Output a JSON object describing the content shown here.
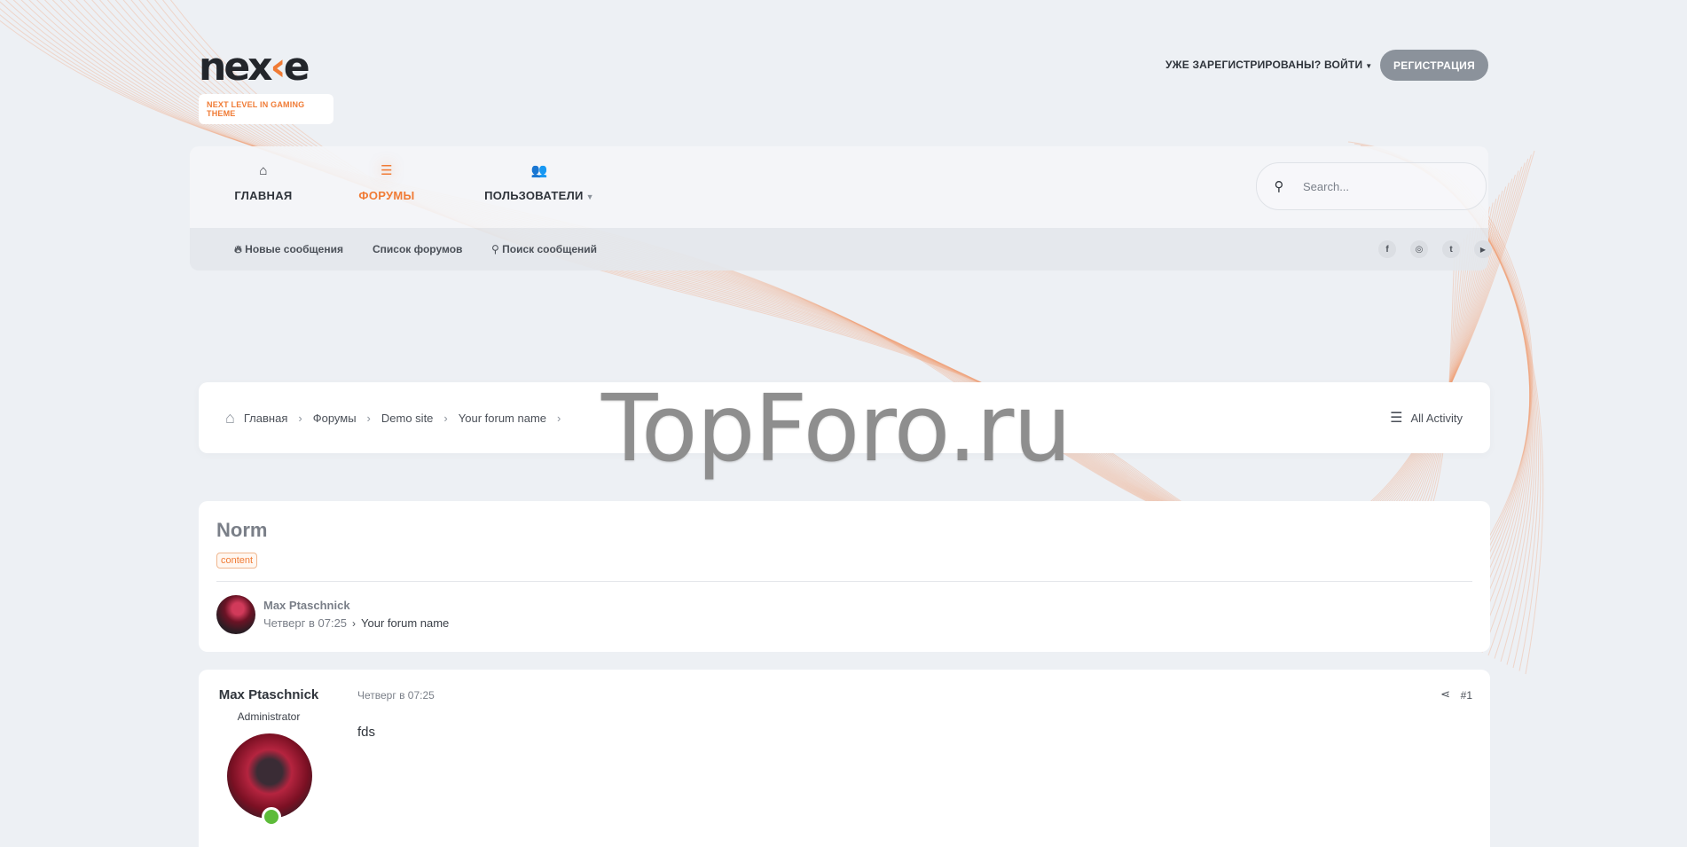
{
  "header": {
    "logo_prefix": "nex",
    "logo_accent": "‹",
    "logo_suffix": "e",
    "tagline": "NEXT LEVEL IN GAMING THEME",
    "login_label": "УЖЕ ЗАРЕГИСТРИРОВАНЫ? ВОЙТИ",
    "register_label": "РЕГИСТРАЦИЯ"
  },
  "nav": {
    "items": [
      {
        "label": "ГЛАВНАЯ",
        "icon": "home-icon",
        "active": false
      },
      {
        "label": "ФОРУМЫ",
        "icon": "list-icon",
        "active": true
      },
      {
        "label": "ПОЛЬЗОВАТЕЛИ",
        "icon": "users-icon",
        "active": false
      }
    ],
    "search_placeholder": "Search..."
  },
  "subnav": {
    "new_posts": "Новые сообщения",
    "forum_list": "Список форумов",
    "search_posts": "Поиск сообщений",
    "social": [
      "f",
      "◎",
      "t",
      "▶"
    ]
  },
  "breadcrumb": {
    "items": [
      "Главная",
      "Форумы",
      "Demo site",
      "Your forum name"
    ],
    "all_activity": "All Activity"
  },
  "watermark": "TopForo.ru",
  "thread": {
    "title": "Norm",
    "tag": "content",
    "author": "Max Ptaschnick",
    "date": "Четверг в 07:25",
    "forum": "Your forum name"
  },
  "post": {
    "author": "Max Ptaschnick",
    "role": "Administrator",
    "date": "Четверг в 07:25",
    "number": "#1",
    "body": "fds"
  },
  "colors": {
    "accent": "#f07b35",
    "background": "#edf0f4",
    "card": "#ffffff",
    "button": "#8b929b",
    "online": "#5dbb3a"
  }
}
